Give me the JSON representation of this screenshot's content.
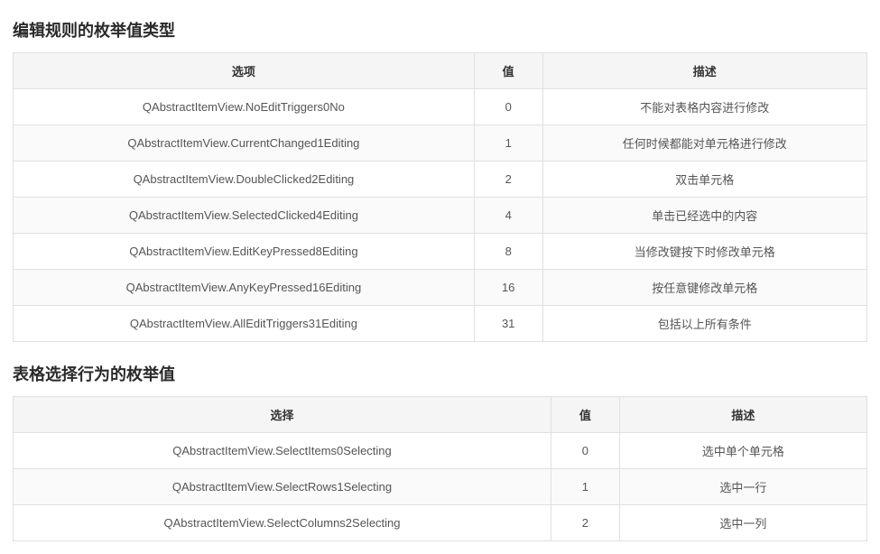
{
  "sections": [
    {
      "title": "编辑规则的枚举值类型",
      "headers": {
        "c0": "选项",
        "c1": "值",
        "c2": "描述"
      },
      "colClasses": [
        "col-opt",
        "col-val",
        "col-desc"
      ],
      "rows": [
        {
          "c0": "QAbstractItemView.NoEditTriggers0No",
          "c1": "0",
          "c2": "不能对表格内容进行修改"
        },
        {
          "c0": "QAbstractItemView.CurrentChanged1Editing",
          "c1": "1",
          "c2": "任何时候都能对单元格进行修改"
        },
        {
          "c0": "QAbstractItemView.DoubleClicked2Editing",
          "c1": "2",
          "c2": "双击单元格"
        },
        {
          "c0": "QAbstractItemView.SelectedClicked4Editing",
          "c1": "4",
          "c2": "单击已经选中的内容"
        },
        {
          "c0": "QAbstractItemView.EditKeyPressed8Editing",
          "c1": "8",
          "c2": "当修改键按下时修改单元格"
        },
        {
          "c0": "QAbstractItemView.AnyKeyPressed16Editing",
          "c1": "16",
          "c2": "按任意键修改单元格"
        },
        {
          "c0": "QAbstractItemView.AllEditTriggers31Editing",
          "c1": "31",
          "c2": "包括以上所有条件"
        }
      ]
    },
    {
      "title": "表格选择行为的枚举值",
      "headers": {
        "c0": "选择",
        "c1": "值",
        "c2": "描述"
      },
      "colClasses": [
        "col2-opt",
        "col2-val",
        "col2-desc"
      ],
      "rows": [
        {
          "c0": "QAbstractItemView.SelectItems0Selecting",
          "c1": "0",
          "c2": "选中单个单元格"
        },
        {
          "c0": "QAbstractItemView.SelectRows1Selecting",
          "c1": "1",
          "c2": "选中一行"
        },
        {
          "c0": "QAbstractItemView.SelectColumns2Selecting",
          "c1": "2",
          "c2": "选中一列"
        }
      ]
    }
  ]
}
